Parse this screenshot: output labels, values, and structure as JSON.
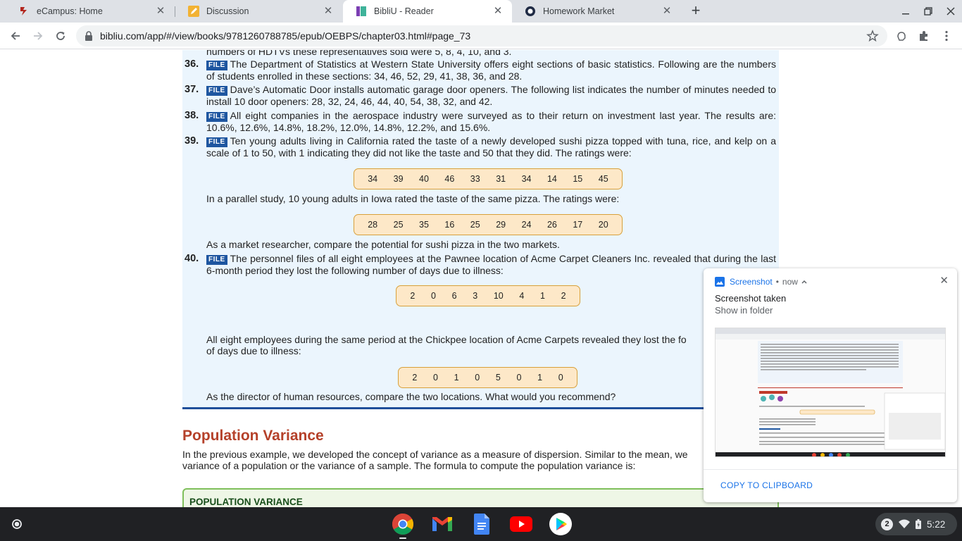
{
  "tabs": [
    {
      "title": "eCampus: Home"
    },
    {
      "title": "Discussion"
    },
    {
      "title": "BibliU - Reader"
    },
    {
      "title": "Homework Market"
    }
  ],
  "omnibox": {
    "url": "bibliu.com/app/#/view/books/9781260788785/epub/OEBPS/chapter03.html#page_73"
  },
  "book": {
    "cut_line": "numbers of HDTVs these representatives sold were 5, 8, 4, 10, and 3.",
    "file_label": "FILE",
    "questions": [
      {
        "num": "36.",
        "text": "The Department of Statistics at Western State University offers eight sections of basic statistics. Following are the numbers of students enrolled in these sections: 34, 46, 52, 29, 41, 38, 36, and 28."
      },
      {
        "num": "37.",
        "text": "Dave’s Automatic Door installs automatic garage door openers. The following list indicates the number of minutes needed to install 10 door openers: 28, 32, 24, 46, 44, 40, 54, 38, 32, and 42."
      },
      {
        "num": "38.",
        "text": "All eight companies in the aerospace industry were surveyed as to their return on investment last year. The results are: 10.6%, 12.6%, 14.8%, 18.2%, 12.0%, 14.8%, 12.2%, and 15.6%."
      },
      {
        "num": "39.",
        "text": "Ten young adults living in California rated the taste of a newly developed sushi pizza topped with tuna, rice, and kelp on a scale of 1 to 50, with 1 indicating they did not like the taste and 50 that they did. The ratings were:"
      },
      {
        "num": "40.",
        "text": "The personnel files of all eight employees at the Pawnee location of Acme Carpet Cleaners Inc. revealed that during the last 6-month period they lost the following number of days due to illness:"
      }
    ],
    "california_ratings": [
      "34",
      "39",
      "40",
      "46",
      "33",
      "31",
      "34",
      "14",
      "15",
      "45"
    ],
    "iowa_intro": "In a parallel study, 10 young adults in Iowa rated the taste of the same pizza. The ratings were:",
    "iowa_ratings": [
      "28",
      "25",
      "35",
      "16",
      "25",
      "29",
      "24",
      "26",
      "17",
      "20"
    ],
    "market_prompt": "As a market researcher, compare the potential for sushi pizza in the two markets.",
    "pawnee_days": [
      "2",
      "0",
      "6",
      "3",
      "10",
      "4",
      "1",
      "2"
    ],
    "chickpee_intro_line1": "All eight employees during the same period at the Chickpee location of Acme Carpets revealed they lost the fo",
    "chickpee_intro_line2": "of days due to illness:",
    "chickpee_days": [
      "2",
      "0",
      "1",
      "0",
      "5",
      "0",
      "1",
      "0"
    ],
    "hr_prompt": "As the director of human resources, compare the two locations. What would you recommend?",
    "section_title": "Population Variance",
    "para_line1": "In the previous example, we developed the concept of variance as a measure of dispersion. Similar to the mean, we",
    "para_line2": "variance of a population or the variance of a sample. The formula to compute the population variance is:",
    "formula_box_title": "POPULATION VARIANCE"
  },
  "notification": {
    "app_name": "Screenshot",
    "time": "now",
    "title": "Screenshot taken",
    "subtitle": "Show in folder",
    "action": "COPY TO CLIPBOARD"
  },
  "tray": {
    "badge": "2",
    "time": "5:22"
  },
  "colors": {
    "accent": "#1a73e8",
    "file_badge": "#1e56a0",
    "section_title": "#b5412a",
    "data_box_fill": "#fde8c8",
    "data_box_border": "#d8a03a"
  }
}
